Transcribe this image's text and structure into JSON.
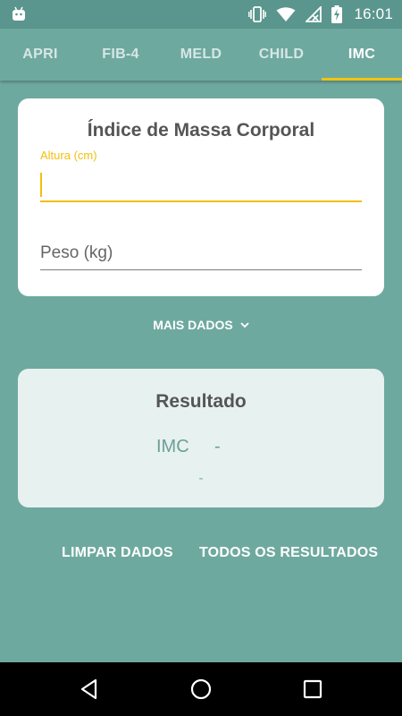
{
  "status_bar": {
    "time": "16:01",
    "icons": [
      "android-icon",
      "vibrate-icon",
      "wifi-icon",
      "no-signal-icon",
      "battery-charging-icon"
    ]
  },
  "tabs": [
    {
      "label": "APRI",
      "active": false
    },
    {
      "label": "FIB-4",
      "active": false
    },
    {
      "label": "MELD",
      "active": false
    },
    {
      "label": "CHILD",
      "active": false
    },
    {
      "label": "IMC",
      "active": true
    }
  ],
  "form": {
    "title": "Índice de Massa Corporal",
    "altura": {
      "label": "Altura (cm)",
      "value": ""
    },
    "peso": {
      "placeholder": "Peso (kg)",
      "value": ""
    }
  },
  "more_data": {
    "label": "MAIS DADOS",
    "icon": "chevron-down-icon"
  },
  "result": {
    "title": "Resultado",
    "imc_label": "IMC",
    "imc_value": "-",
    "classification": "-"
  },
  "actions": {
    "clear_label": "LIMPAR DADOS",
    "all_results_label": "TODOS OS RESULTADOS"
  },
  "colors": {
    "background": "#6ea9a0",
    "accent": "#f2c40f",
    "status_bar": "#5a968d"
  }
}
